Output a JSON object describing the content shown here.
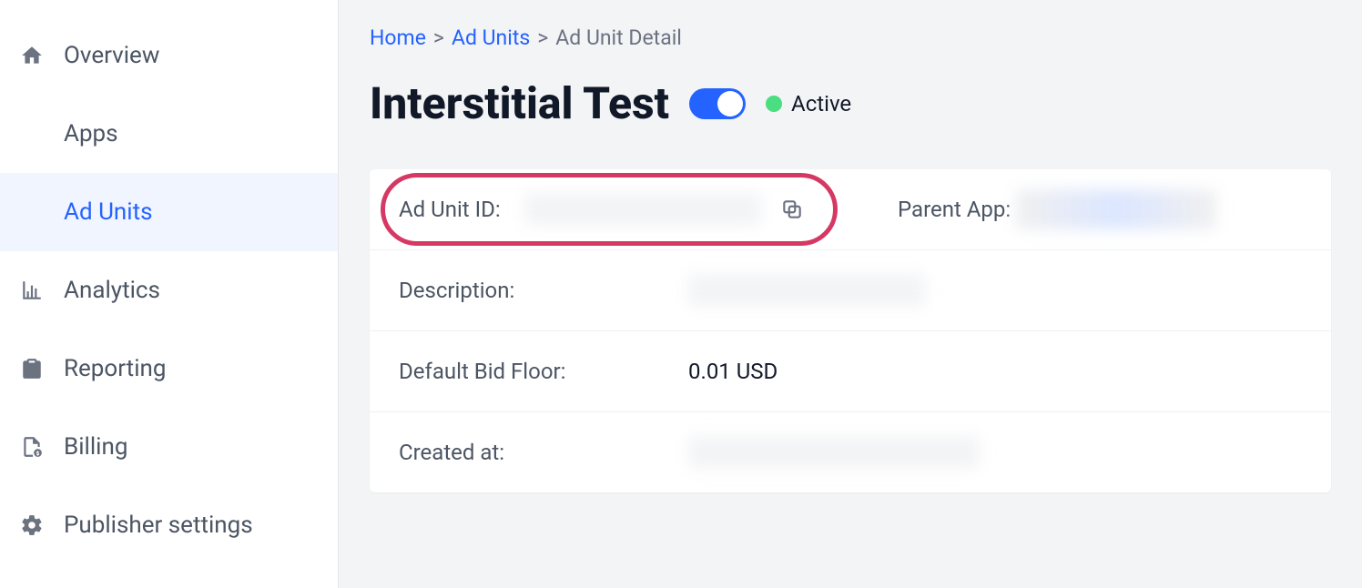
{
  "sidebar": {
    "items": [
      {
        "label": "Overview",
        "icon": "home-icon"
      },
      {
        "label": "Apps",
        "icon": ""
      },
      {
        "label": "Ad Units",
        "icon": ""
      },
      {
        "label": "Analytics",
        "icon": "analytics-icon"
      },
      {
        "label": "Reporting",
        "icon": "reporting-icon"
      },
      {
        "label": "Billing",
        "icon": "billing-icon"
      },
      {
        "label": "Publisher settings",
        "icon": "settings-icon"
      }
    ]
  },
  "breadcrumb": {
    "home": "Home",
    "section": "Ad Units",
    "current": "Ad Unit Detail",
    "sep": ">"
  },
  "header": {
    "title": "Interstitial Test",
    "status": "Active",
    "toggle_on": true
  },
  "detail": {
    "ad_unit_id_label": "Ad Unit ID:",
    "ad_unit_id_value": "",
    "parent_app_label": "Parent App:",
    "parent_app_value": "",
    "description_label": "Description:",
    "description_value": "",
    "bid_floor_label": "Default Bid Floor:",
    "bid_floor_value": "0.01 USD",
    "created_at_label": "Created at:",
    "created_at_value": ""
  }
}
